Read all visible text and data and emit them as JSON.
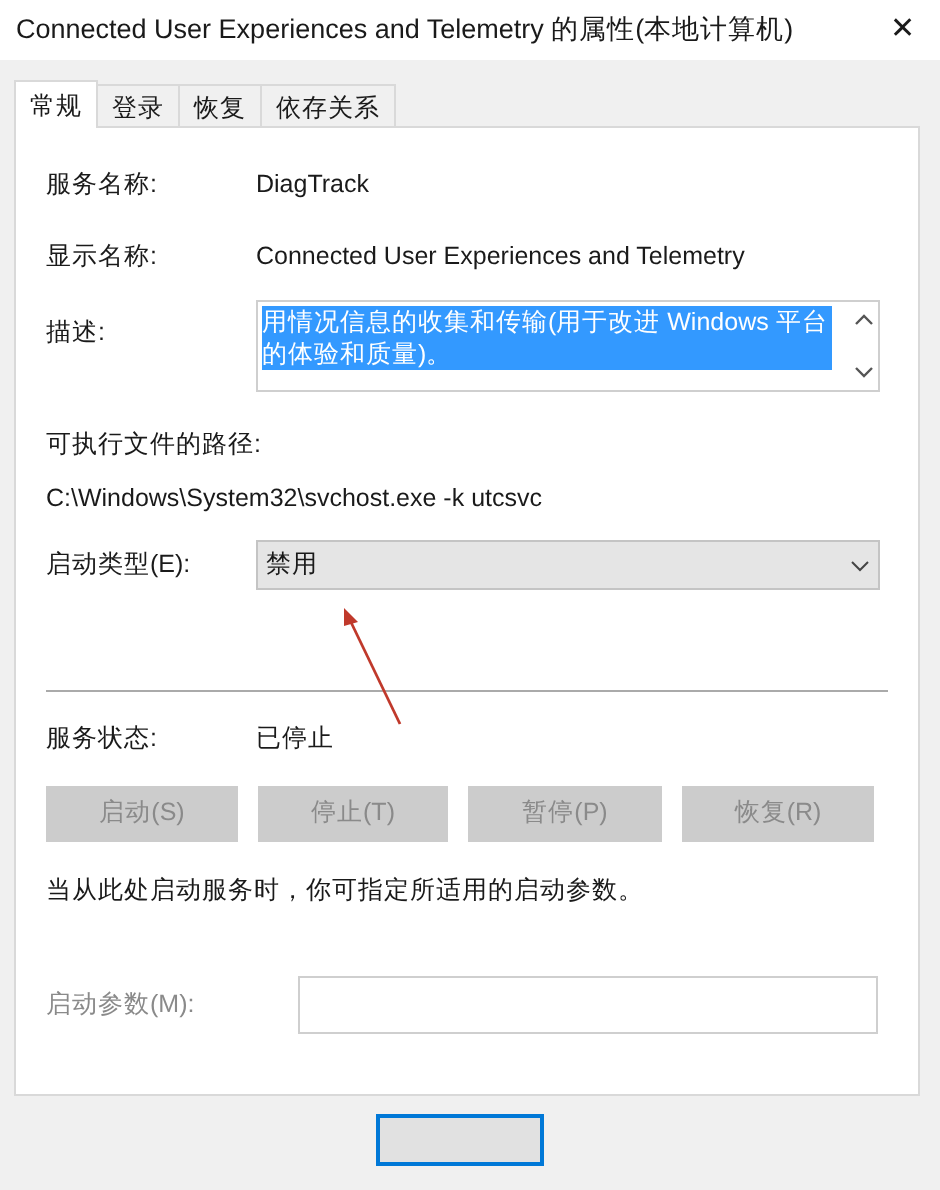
{
  "window": {
    "title": "Connected User Experiences and Telemetry 的属性(本地计算机)",
    "close": "✕"
  },
  "tabs": [
    {
      "label": "常规",
      "selected": true
    },
    {
      "label": "登录",
      "selected": false
    },
    {
      "label": "恢复",
      "selected": false
    },
    {
      "label": "依存关系",
      "selected": false
    }
  ],
  "fields": [
    {
      "label": "服务名称:",
      "value": "DiagTrack"
    },
    {
      "label": "显示名称:",
      "value": "Connected User Experiences and Telemetry"
    }
  ],
  "description": {
    "label": "描述:",
    "value": "用情况信息的收集和传输(用于改进 Windows 平台的体验和质量)。",
    "selected": true
  },
  "path": {
    "label": "可执行文件的路径:",
    "value": "C:\\Windows\\System32\\svchost.exe -k utcsvc"
  },
  "startup_type": {
    "label": "启动类型(E):",
    "value": "禁用"
  },
  "service_status": {
    "label": "服务状态:",
    "value": "已停止"
  },
  "service_buttons": [
    {
      "label": "启动(S)",
      "disabled": true
    },
    {
      "label": "停止(T)",
      "disabled": true
    },
    {
      "label": "暂停(P)",
      "disabled": true
    },
    {
      "label": "恢复(R)",
      "disabled": true
    }
  ],
  "note": "当从此处启动服务时，你可指定所适用的启动参数。",
  "start_params": {
    "label": "启动参数(M):",
    "disabled": true
  }
}
